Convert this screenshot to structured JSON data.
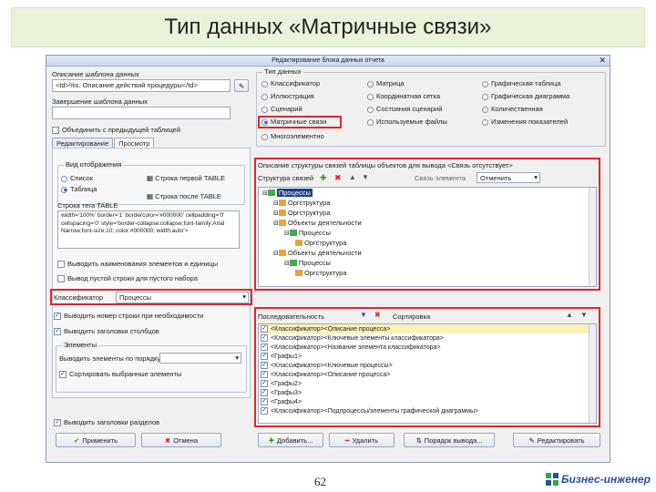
{
  "slide": {
    "title": "Тип данных «Матричные связи»",
    "page_number": "62",
    "logo_text": "Бизнес-инженер"
  },
  "window": {
    "title": "Редактирование блока данных отчета",
    "desc_label": "Описание шаблона данных",
    "desc_value": "<td>%s. Описание действий процедуры</td>",
    "sep_label": "Завершение шаблона данных",
    "combine_prev": "Объединить с предыдущей таблицей",
    "tabs": [
      "Редактирование",
      "Просмотр"
    ],
    "data_type_caption": "Тип данных",
    "data_types": [
      [
        "Классификатор",
        "Матрица",
        "Графическая таблица"
      ],
      [
        "Иллюстрация",
        "Координатная сетка",
        "Графическая диаграмма"
      ],
      [
        "Сценарий",
        "Состояния сценарий",
        "Количественная"
      ],
      [
        "Матричные связи",
        "Используемые файлы",
        "Изменения показателей"
      ],
      [
        "Многоэлементно",
        "",
        ""
      ]
    ],
    "view_caption": "Вид отображения",
    "view_options": [
      "Список",
      "Таблица"
    ],
    "row_first_label": "Строка первой TABLE",
    "row_last_label": "Строка после TABLE",
    "row_table_label": "Строка тега TABLE",
    "html_text": "width='100%' border='1' bordercolor='#000000' cellpadding='0' cellspacing='0' style='border-collapse:collapse;font-family:Arial Narrow;font-size:10; color:#000000; width:auto'>",
    "chk_heading": "Выводить наименования элементов и единицы",
    "chk_heading2": "Вывод пустой строки для пустого набора",
    "classifier_label": "Классификатор",
    "classifier_value": "Процессы",
    "chk_number": "Выводить номер строки при необходимости",
    "chk_summary": "Выводить заголовки столбцов",
    "elements_caption": "Элементы",
    "elements_order": "Выводить элементы по порядку",
    "elements_sort": "Сортировать выбранные элементы",
    "chk_bottom": "Выводить заголовки разделов",
    "buttons": {
      "apply": "Применить",
      "cancel": "Отмена",
      "add": "Добавить...",
      "delete": "Удалить",
      "order": "Порядок вывода...",
      "edit": "Редактировать"
    },
    "struct_caption": "Описание структуры связей таблицы объектов для вывода <Связь отсутствует>",
    "struct_label": "Структура связей",
    "struct_right_label": "Связь элемента",
    "struct_combo": "Отменить",
    "tree": [
      {
        "level": 0,
        "text": "Процессы",
        "sel": true
      },
      {
        "level": 1,
        "text": "Оргструктура",
        "sel": false
      },
      {
        "level": 1,
        "text": "Оргструктура",
        "sel": false
      },
      {
        "level": 1,
        "text": "Объекты деятельности",
        "sel": false
      },
      {
        "level": 2,
        "text": "Процессы",
        "sel": false
      },
      {
        "level": 3,
        "text": "Оргструктура",
        "sel": false
      },
      {
        "level": 1,
        "text": "Объекты деятельности",
        "sel": false
      },
      {
        "level": 2,
        "text": "Процессы",
        "sel": false
      },
      {
        "level": 3,
        "text": "Оргструктура",
        "sel": false
      }
    ],
    "elements_list_caption": "Последовательность",
    "elements_list_right": "Сортировка",
    "elements": [
      "<Классификатор><Описание процесса>",
      "<Классификатор><Ключевые элементы классификатора>",
      "<Классификатор><Название элемента классификатора>",
      "<Графы1>",
      "<Классификатор><Ключевые процессы>",
      "<Классификатор><Описание процесса>",
      "<Графы2>",
      "<Графы3>",
      "<Графы4>",
      "<Классификатор><Подпроцессы/элементы графической диаграммы>"
    ]
  },
  "colors": {
    "highlight": "#e0262f",
    "title_bg": "#e8f3da",
    "selection": "#fbf2b8"
  }
}
